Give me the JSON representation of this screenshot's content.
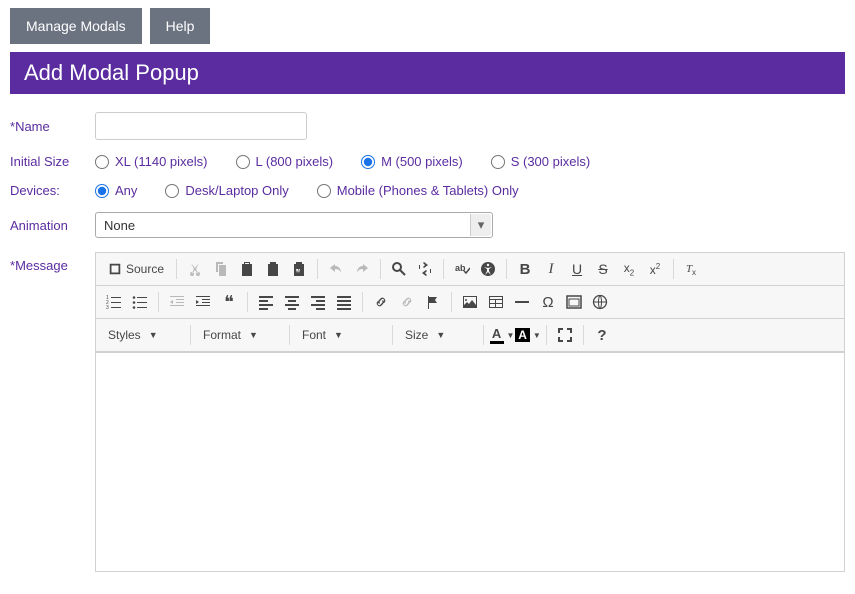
{
  "tabs": {
    "manage": "Manage Modals",
    "help": "Help"
  },
  "title": "Add Modal Popup",
  "labels": {
    "name": "Name",
    "initialSize": "Initial Size",
    "devices": "Devices:",
    "animation": "Animation",
    "message": "Message"
  },
  "name_value": "",
  "sizes": {
    "xl": "XL (1140 pixels)",
    "l": "L (800 pixels)",
    "m": "M (500 pixels)",
    "s": "S (300 pixels)",
    "selected": "m"
  },
  "devices": {
    "any": "Any",
    "desk": "Desk/Laptop Only",
    "mobile": "Mobile (Phones & Tablets) Only",
    "selected": "any"
  },
  "animation": {
    "value": "None"
  },
  "editor": {
    "source": "Source",
    "styles": "Styles",
    "format": "Format",
    "font": "Font",
    "size": "Size"
  }
}
